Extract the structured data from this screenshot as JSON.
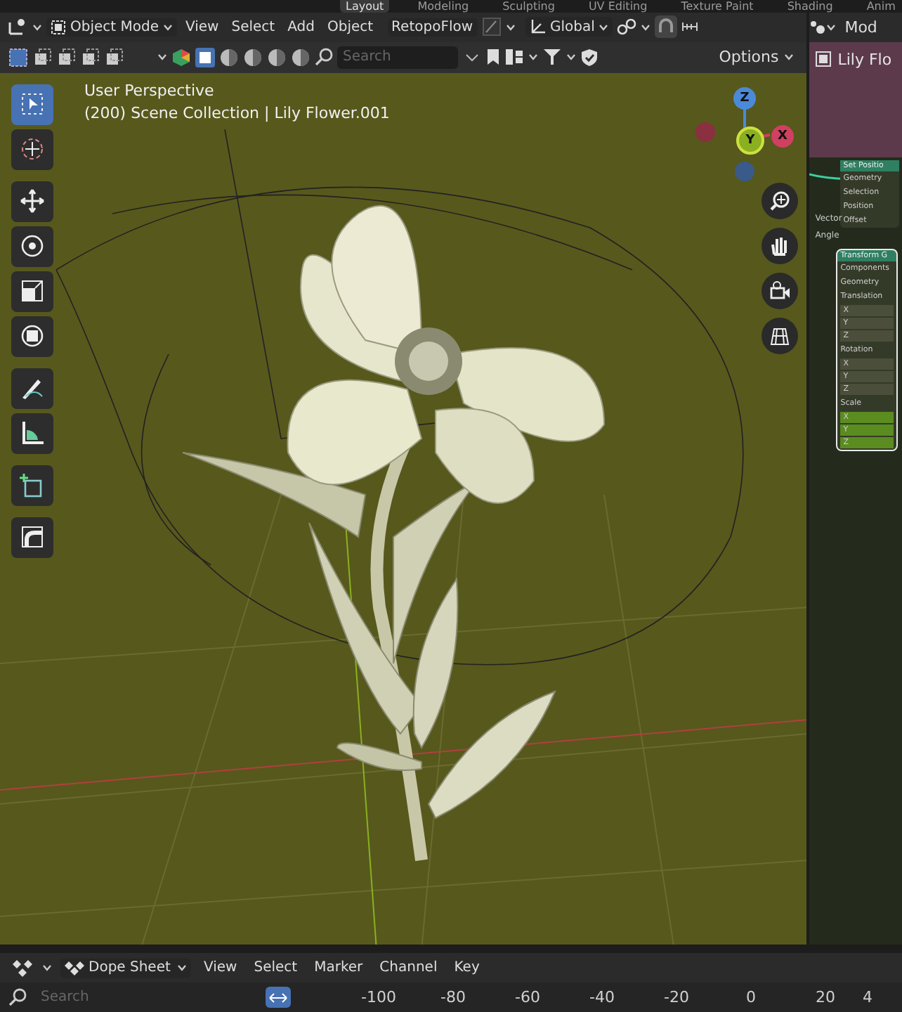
{
  "workspace_tabs": [
    {
      "label": "Layout",
      "selected": true
    },
    {
      "label": "Modeling",
      "selected": false
    },
    {
      "label": "Sculpting",
      "selected": false
    },
    {
      "label": "UV Editing",
      "selected": false
    },
    {
      "label": "Texture Paint",
      "selected": false
    },
    {
      "label": "Shading",
      "selected": false
    },
    {
      "label": "Anim",
      "selected": false
    }
  ],
  "header": {
    "mode": "Object Mode",
    "menus": [
      "View",
      "Select",
      "Add",
      "Object"
    ],
    "addon": "RetopoFlow",
    "orientation": "Global",
    "right_mode": "Mod"
  },
  "subheader": {
    "search_placeholder": "Search",
    "options": "Options"
  },
  "viewport": {
    "view_name": "User Perspective",
    "context": "(200) Scene Collection | Lily Flower.001",
    "tools": [
      {
        "selected": true
      },
      {
        "selected": false
      },
      {
        "selected": false
      },
      {
        "selected": false
      },
      {
        "selected": false
      },
      {
        "selected": false
      },
      {
        "selected": false
      },
      {
        "selected": false
      },
      {
        "selected": false
      },
      {
        "selected": false
      }
    ],
    "gizmo_axes": [
      "Z",
      "Y",
      "X"
    ]
  },
  "side_panel": {
    "title": "Lily Flo",
    "nodes": [
      {
        "title": "Set Positio",
        "sockets": [
          "Geometry",
          "Selection",
          "Position",
          "Offset"
        ]
      },
      {
        "title": "Transform G",
        "sockets": [
          "Components",
          "Geometry",
          "Translation",
          "X",
          "Y",
          "Z",
          "Rotation",
          "X",
          "Y",
          "Z",
          "Scale",
          "X",
          "Y",
          "Z"
        ]
      }
    ],
    "input_labels": [
      "Vector",
      "Angle"
    ]
  },
  "dope_sheet": {
    "editor": "Dope Sheet",
    "menus": [
      "View",
      "Select",
      "Marker",
      "Channel",
      "Key"
    ],
    "search_placeholder": "Search",
    "ticks": [
      "-100",
      "-80",
      "-60",
      "-40",
      "-20",
      "0",
      "20",
      "4"
    ]
  }
}
